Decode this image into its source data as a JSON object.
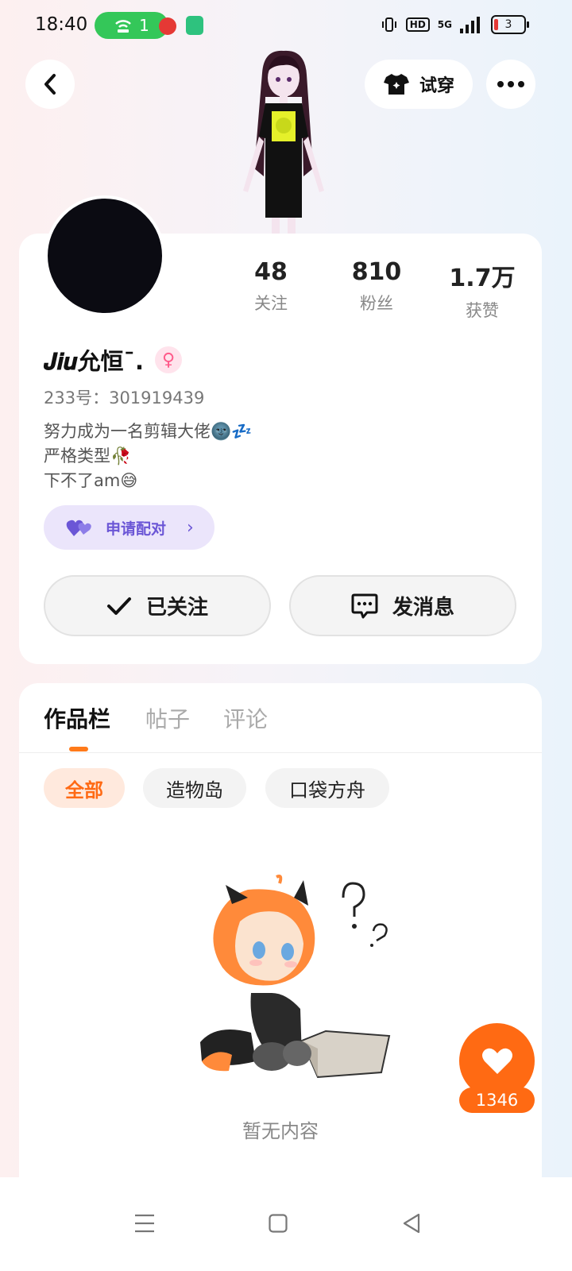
{
  "status_bar": {
    "time": "18:40",
    "hotspot_count": "1",
    "network": "5G",
    "hd": "HD",
    "battery": "3"
  },
  "header": {
    "try_on_label": "试穿"
  },
  "stats": [
    {
      "value": "48",
      "label": "关注"
    },
    {
      "value": "810",
      "label": "粉丝"
    },
    {
      "value": "1.7万",
      "label": "获赞"
    }
  ],
  "profile": {
    "name": "𝑱𝒊𝒖允恒ˉ.",
    "gender_symbol": "♀",
    "id_text": "233号：301919439",
    "bio": [
      "努力成为一名剪辑大佬🌚💤",
      "严格类型🥀",
      "下不了am😅"
    ],
    "pair_label": "申请配对",
    "follow_label": "已关注",
    "message_label": "发消息"
  },
  "works": {
    "tabs": [
      "作品栏",
      "帖子",
      "评论"
    ],
    "chips": [
      "全部",
      "造物岛",
      "口袋方舟"
    ],
    "empty_text": "暂无内容"
  },
  "like": {
    "count": "1346"
  },
  "colors": {
    "accent": "#ff6a13",
    "pair_purple": "#6b56d6",
    "hotspot_green": "#34c759"
  }
}
